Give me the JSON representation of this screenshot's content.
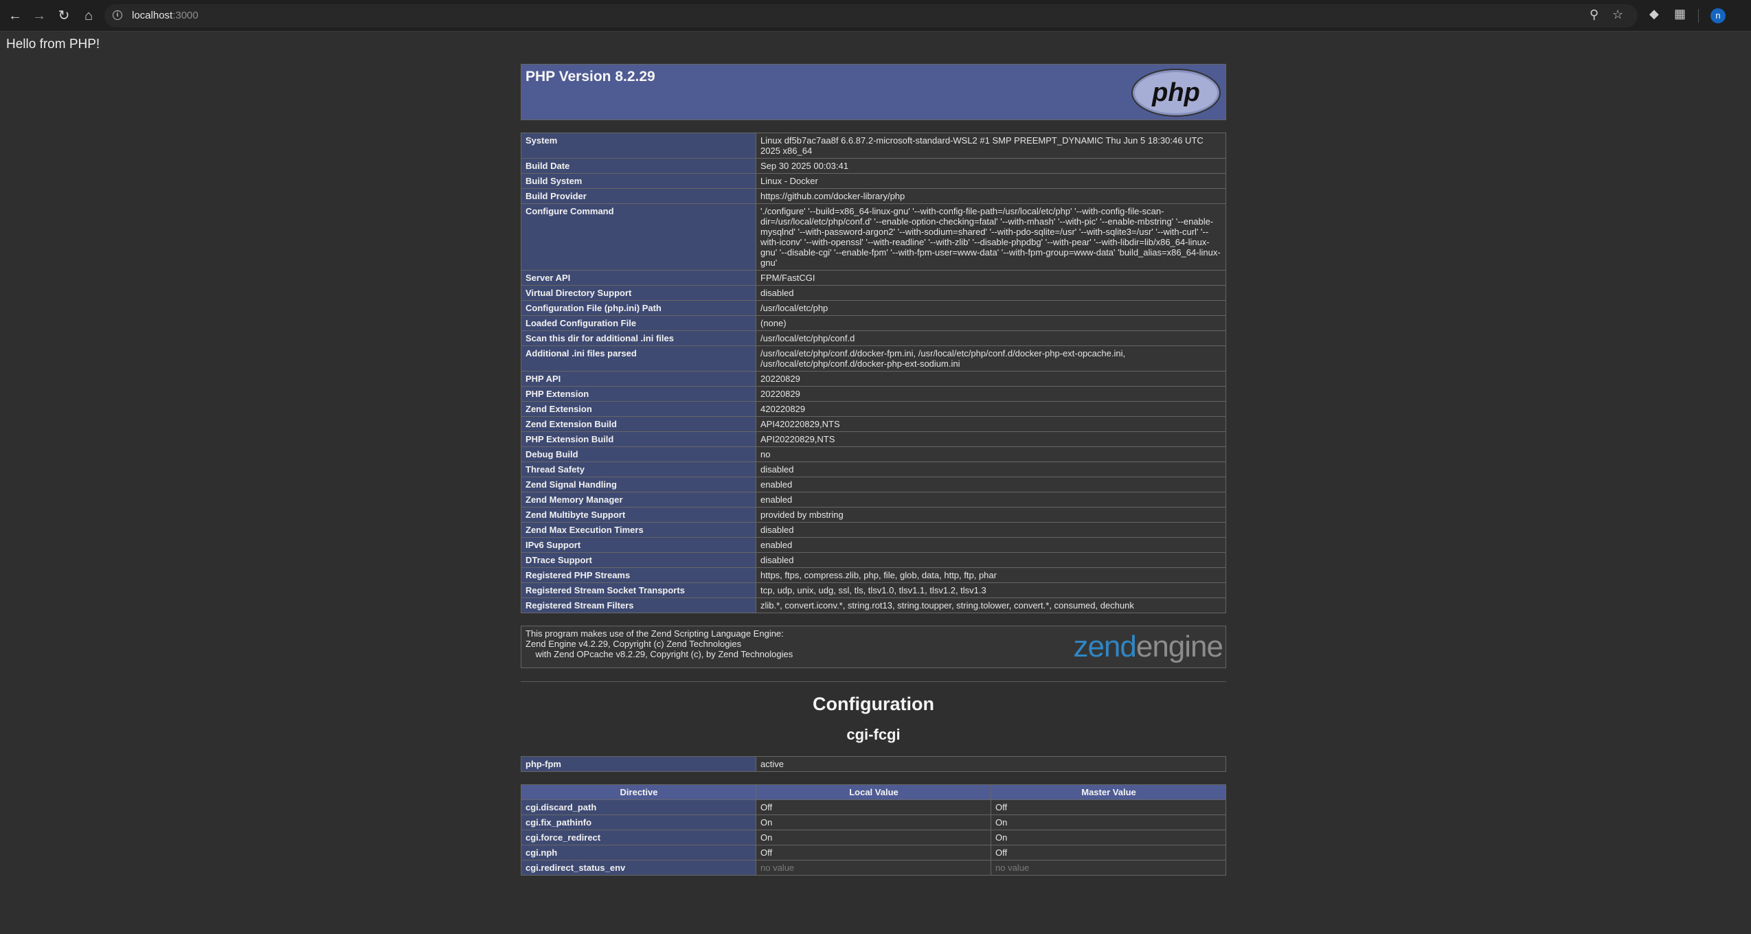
{
  "browser": {
    "url_host": "localhost",
    "url_port": ":3000"
  },
  "page": {
    "hello": "Hello from PHP!",
    "version_title": "PHP Version 8.2.29",
    "logo_text": "php"
  },
  "info_rows": [
    {
      "k": "System",
      "v": "Linux df5b7ac7aa8f 6.6.87.2-microsoft-standard-WSL2 #1 SMP PREEMPT_DYNAMIC Thu Jun 5 18:30:46 UTC 2025 x86_64"
    },
    {
      "k": "Build Date",
      "v": "Sep 30 2025 00:03:41"
    },
    {
      "k": "Build System",
      "v": "Linux - Docker"
    },
    {
      "k": "Build Provider",
      "v": "https://github.com/docker-library/php"
    },
    {
      "k": "Configure Command",
      "v": "'./configure' '--build=x86_64-linux-gnu' '--with-config-file-path=/usr/local/etc/php' '--with-config-file-scan-dir=/usr/local/etc/php/conf.d' '--enable-option-checking=fatal' '--with-mhash' '--with-pic' '--enable-mbstring' '--enable-mysqlnd' '--with-password-argon2' '--with-sodium=shared' '--with-pdo-sqlite=/usr' '--with-sqlite3=/usr' '--with-curl' '--with-iconv' '--with-openssl' '--with-readline' '--with-zlib' '--disable-phpdbg' '--with-pear' '--with-libdir=lib/x86_64-linux-gnu' '--disable-cgi' '--enable-fpm' '--with-fpm-user=www-data' '--with-fpm-group=www-data' 'build_alias=x86_64-linux-gnu'"
    },
    {
      "k": "Server API",
      "v": "FPM/FastCGI"
    },
    {
      "k": "Virtual Directory Support",
      "v": "disabled"
    },
    {
      "k": "Configuration File (php.ini) Path",
      "v": "/usr/local/etc/php"
    },
    {
      "k": "Loaded Configuration File",
      "v": "(none)"
    },
    {
      "k": "Scan this dir for additional .ini files",
      "v": "/usr/local/etc/php/conf.d"
    },
    {
      "k": "Additional .ini files parsed",
      "v": "/usr/local/etc/php/conf.d/docker-fpm.ini, /usr/local/etc/php/conf.d/docker-php-ext-opcache.ini, /usr/local/etc/php/conf.d/docker-php-ext-sodium.ini"
    },
    {
      "k": "PHP API",
      "v": "20220829"
    },
    {
      "k": "PHP Extension",
      "v": "20220829"
    },
    {
      "k": "Zend Extension",
      "v": "420220829"
    },
    {
      "k": "Zend Extension Build",
      "v": "API420220829,NTS"
    },
    {
      "k": "PHP Extension Build",
      "v": "API20220829,NTS"
    },
    {
      "k": "Debug Build",
      "v": "no"
    },
    {
      "k": "Thread Safety",
      "v": "disabled"
    },
    {
      "k": "Zend Signal Handling",
      "v": "enabled"
    },
    {
      "k": "Zend Memory Manager",
      "v": "enabled"
    },
    {
      "k": "Zend Multibyte Support",
      "v": "provided by mbstring"
    },
    {
      "k": "Zend Max Execution Timers",
      "v": "disabled"
    },
    {
      "k": "IPv6 Support",
      "v": "enabled"
    },
    {
      "k": "DTrace Support",
      "v": "disabled"
    },
    {
      "k": "Registered PHP Streams",
      "v": "https, ftps, compress.zlib, php, file, glob, data, http, ftp, phar"
    },
    {
      "k": "Registered Stream Socket Transports",
      "v": "tcp, udp, unix, udg, ssl, tls, tlsv1.0, tlsv1.1, tlsv1.2, tlsv1.3"
    },
    {
      "k": "Registered Stream Filters",
      "v": "zlib.*, convert.iconv.*, string.rot13, string.toupper, string.tolower, convert.*, consumed, dechunk"
    }
  ],
  "zend": {
    "line1": "This program makes use of the Zend Scripting Language Engine:",
    "line2": "Zend Engine v4.2.29, Copyright (c) Zend Technologies",
    "line3": "    with Zend OPcache v8.2.29, Copyright (c), by Zend Technologies",
    "logo_a": "zend",
    "logo_b": "engine"
  },
  "configuration": {
    "title": "Configuration",
    "module": "cgi-fcgi",
    "status_row": {
      "k": "php-fpm",
      "v": "active"
    },
    "headers": [
      "Directive",
      "Local Value",
      "Master Value"
    ],
    "directives": [
      {
        "d": "cgi.discard_path",
        "l": "Off",
        "m": "Off",
        "nv": false
      },
      {
        "d": "cgi.fix_pathinfo",
        "l": "On",
        "m": "On",
        "nv": false
      },
      {
        "d": "cgi.force_redirect",
        "l": "On",
        "m": "On",
        "nv": false
      },
      {
        "d": "cgi.nph",
        "l": "Off",
        "m": "Off",
        "nv": false
      },
      {
        "d": "cgi.redirect_status_env",
        "l": "no value",
        "m": "no value",
        "nv": true
      }
    ]
  }
}
